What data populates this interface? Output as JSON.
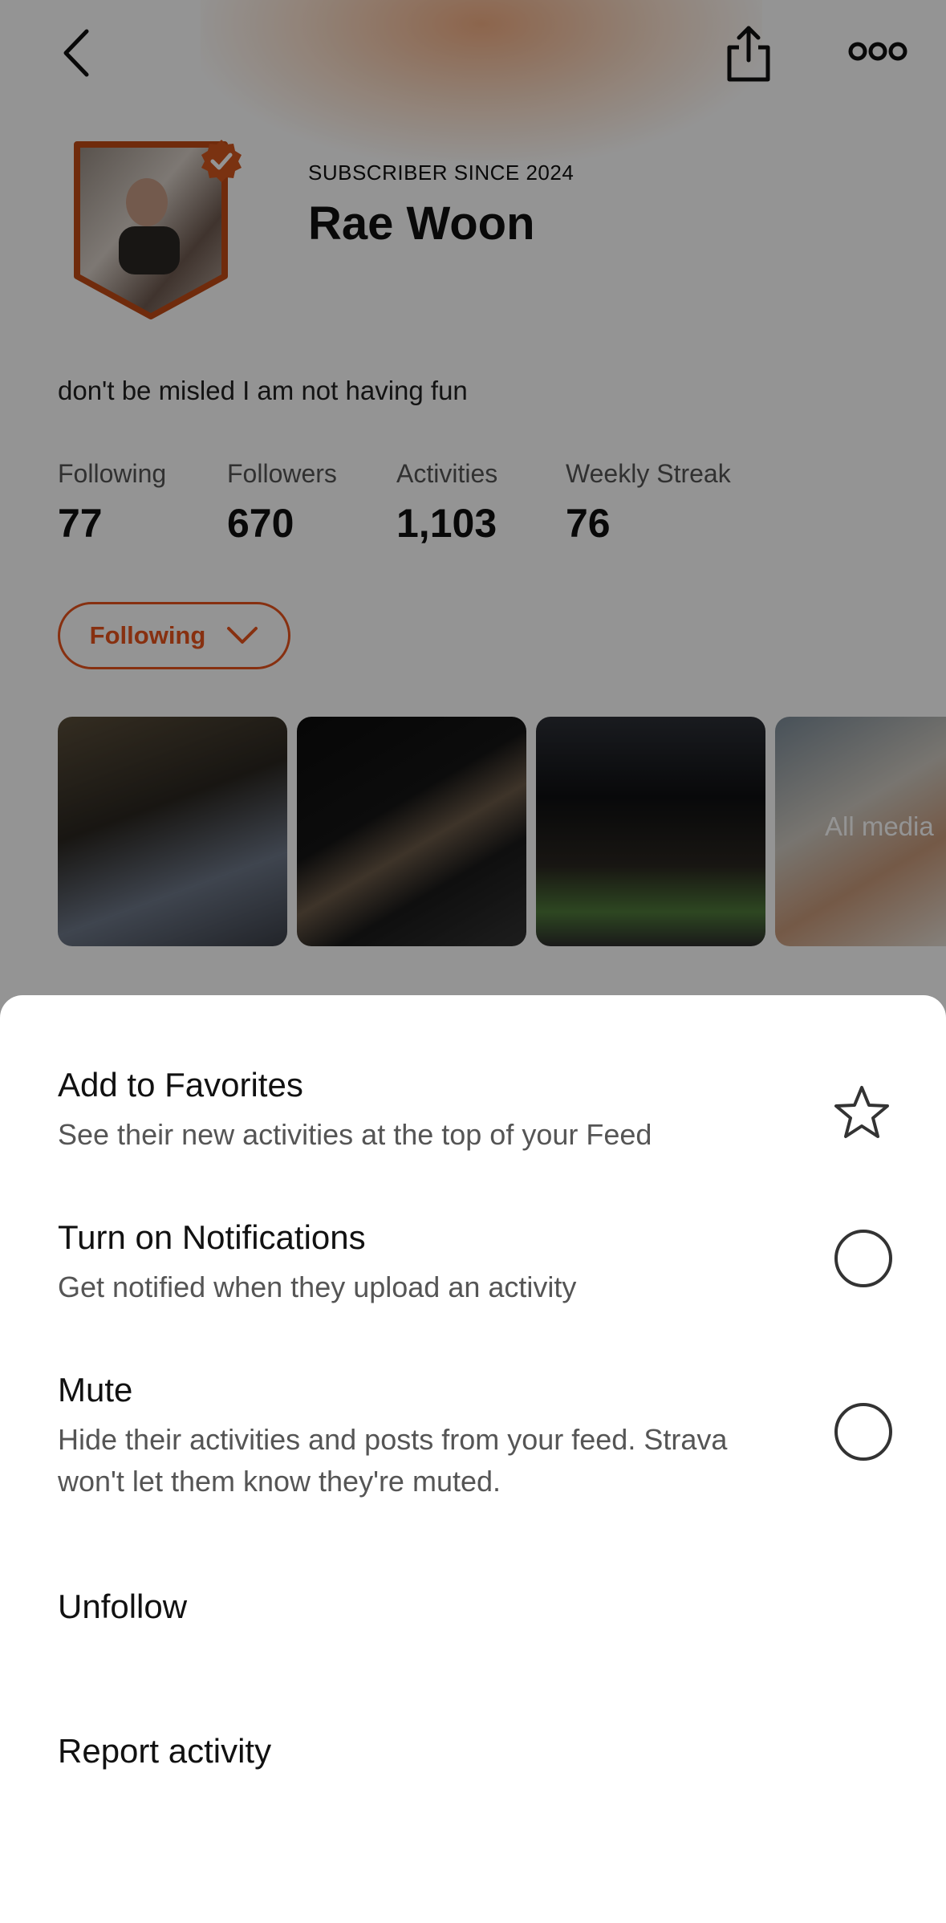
{
  "profile": {
    "subscriber_label": "SUBSCRIBER SINCE 2024",
    "name": "Rae Woon",
    "bio": "don't be misled I am not having fun",
    "stats": [
      {
        "label": "Following",
        "value": "77"
      },
      {
        "label": "Followers",
        "value": "670"
      },
      {
        "label": "Activities",
        "value": "1,103"
      },
      {
        "label": "Weekly Streak",
        "value": "76"
      }
    ],
    "follow_button_label": "Following",
    "all_media_label": "All media"
  },
  "sheet": {
    "favorites_title": "Add to Favorites",
    "favorites_desc": "See their new activities at the top of your Feed",
    "notifications_title": "Turn on Notifications",
    "notifications_desc": "Get notified when they upload an activity",
    "mute_title": "Mute",
    "mute_desc": "Hide their activities and posts from your feed. Strava won't let them know they're muted.",
    "unfollow_label": "Unfollow",
    "report_label": "Report activity"
  },
  "colors": {
    "accent": "#e8531c",
    "overlay": "rgba(0,0,0,0.42)"
  },
  "icons": [
    "back-arrow-icon",
    "share-icon",
    "more-icon",
    "subscriber-badge-icon",
    "chevron-down-icon",
    "star-icon"
  ]
}
